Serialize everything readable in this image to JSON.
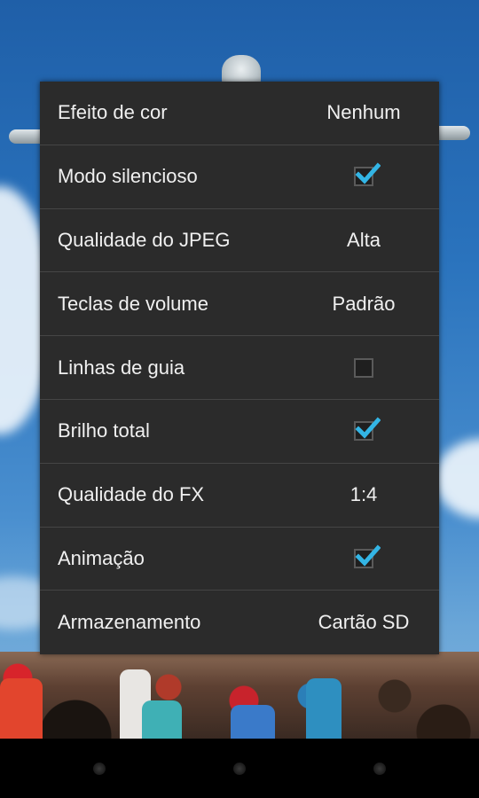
{
  "settings": {
    "items": [
      {
        "label": "Efeito de cor",
        "type": "value",
        "value": "Nenhum"
      },
      {
        "label": "Modo silencioso",
        "type": "checkbox",
        "checked": true
      },
      {
        "label": "Qualidade do JPEG",
        "type": "value",
        "value": "Alta"
      },
      {
        "label": "Teclas de volume",
        "type": "value",
        "value": "Padrão"
      },
      {
        "label": "Linhas de guia",
        "type": "checkbox",
        "checked": false
      },
      {
        "label": "Brilho total",
        "type": "checkbox",
        "checked": true
      },
      {
        "label": "Qualidade do FX",
        "type": "value",
        "value": "1:4"
      },
      {
        "label": "Animação",
        "type": "checkbox",
        "checked": true
      },
      {
        "label": "Armazenamento",
        "type": "value",
        "value": "Cartão SD"
      }
    ]
  },
  "colors": {
    "popup_bg": "#2b2b2b",
    "divider": "#454545",
    "check_accent": "#33b5e5",
    "text": "#f0f0f0"
  },
  "navbar": {
    "buttons": [
      "back-icon",
      "home-icon",
      "recent-apps-icon"
    ]
  }
}
